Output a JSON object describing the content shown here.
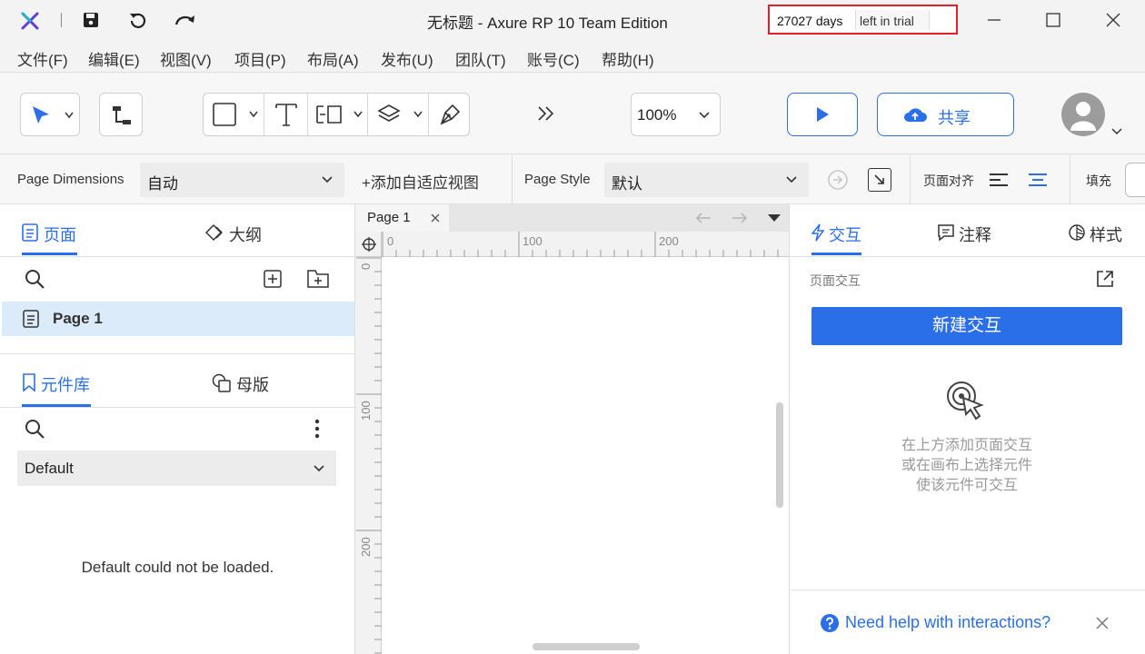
{
  "titlebar": {
    "title": "无标题 - Axure RP 10 Team Edition",
    "trial_days": "27027 days",
    "trial_suffix": "left in trial"
  },
  "menu": [
    "文件(F)",
    "编辑(E)",
    "视图(V)",
    "项目(P)",
    "布局(A)",
    "发布(U)",
    "团队(T)",
    "账号(C)",
    "帮助(H)"
  ],
  "toolbar": {
    "zoom": "100%",
    "share_label": "共享"
  },
  "propbar": {
    "page_dimensions_label": "Page Dimensions",
    "page_dimensions_value": "自动",
    "add_adaptive": "+添加自适应视图",
    "page_style_label": "Page Style",
    "page_style_value": "默认",
    "align_label": "页面对齐",
    "fill_label": "填充"
  },
  "left": {
    "tabs": [
      "页面",
      "大纲"
    ],
    "pages": [
      "Page 1"
    ],
    "lib_tabs": [
      "元件库",
      "母版"
    ],
    "library_value": "Default",
    "library_error": "Default could not be loaded."
  },
  "canvas": {
    "tab_label": "Page 1",
    "ruler_h": [
      "0",
      "100",
      "200"
    ],
    "ruler_v": [
      "0",
      "100",
      "200"
    ]
  },
  "right": {
    "tabs": [
      "交互",
      "注释",
      "样式"
    ],
    "section_title": "页面交互",
    "new_interaction": "新建交互",
    "hint_lines": [
      "在上方添加页面交互",
      "或在画布上选择元件",
      "使该元件可交互"
    ],
    "help_text": "Need help with interactions?"
  },
  "colors": {
    "accent": "#2b6fe8",
    "trial_border": "#e0202b"
  }
}
